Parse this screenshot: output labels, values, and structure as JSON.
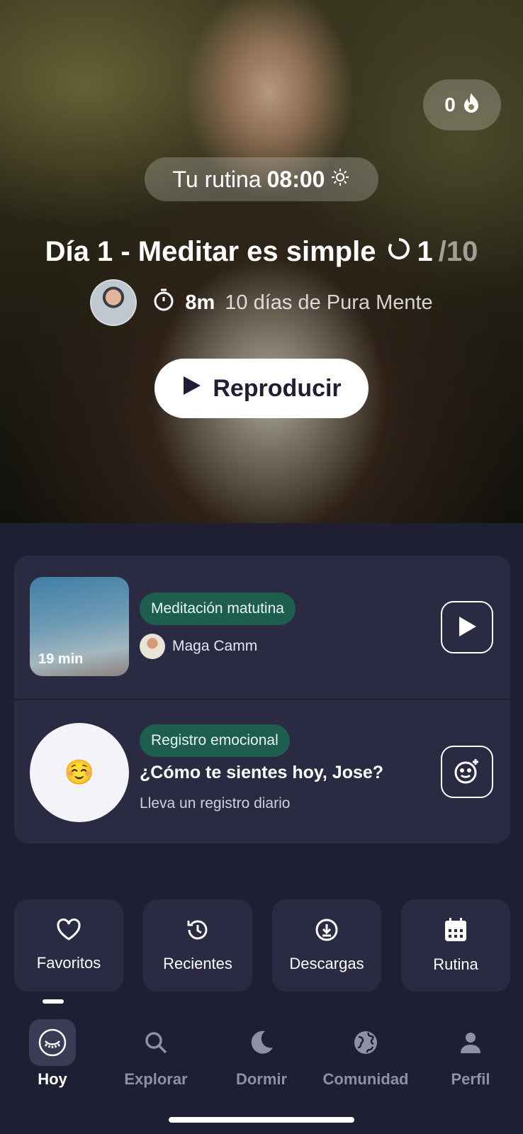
{
  "hero": {
    "streak_count": "0",
    "routine_label": "Tu rutina",
    "routine_time": "08:00",
    "title": "Día 1 - Meditar es simple",
    "progress_current": "1",
    "progress_total": "/10",
    "duration": "8m",
    "series": "10 días de Pura Mente",
    "play_label": "Reproducir"
  },
  "cards": {
    "morning": {
      "thumb_label": "19 min",
      "tag": "Meditación matutina",
      "author": "Maga Camm"
    },
    "mood": {
      "emoji": "☺️",
      "tag": "Registro emocional",
      "question": "¿Cómo te sientes hoy, Jose?",
      "subtitle": "Lleva un registro diario"
    }
  },
  "tiles": [
    {
      "label": "Favoritos",
      "icon": "heart-icon"
    },
    {
      "label": "Recientes",
      "icon": "history-icon"
    },
    {
      "label": "Descargas",
      "icon": "download-icon"
    },
    {
      "label": "Rutina",
      "icon": "calendar-icon"
    }
  ],
  "nav": [
    {
      "label": "Hoy",
      "icon": "closed-eye-icon",
      "active": true
    },
    {
      "label": "Explorar",
      "icon": "search-icon"
    },
    {
      "label": "Dormir",
      "icon": "moon-icon"
    },
    {
      "label": "Comunidad",
      "icon": "globe-icon"
    },
    {
      "label": "Perfil",
      "icon": "person-icon"
    }
  ],
  "colors": {
    "background": "#1f1f33",
    "card": "#2a2a43",
    "tag_green": "#1d5e4f",
    "text": "#ffffff",
    "nav_inactive": "#8f8fa6"
  }
}
